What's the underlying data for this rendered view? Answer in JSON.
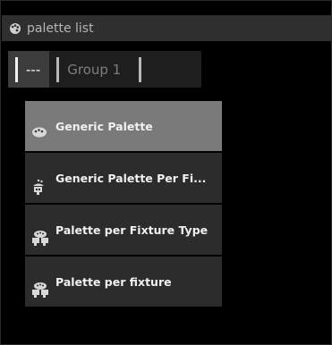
{
  "window": {
    "title": "palette list"
  },
  "tabs": [
    {
      "label": "---",
      "active": true
    },
    {
      "label": "Group 1",
      "active": false
    },
    {
      "label": "",
      "active": false
    }
  ],
  "palettes": [
    {
      "label": "Generic Palette",
      "icon": "palette-icon",
      "selected": true
    },
    {
      "label": "Generic Palette Per Fi...",
      "icon": "palette-fixture-icon",
      "selected": false
    },
    {
      "label": "Palette per Fixture Type",
      "icon": "palette-fixture-type-icon",
      "selected": false
    },
    {
      "label": "Palette per fixture",
      "icon": "palette-per-fixture-icon",
      "selected": false
    }
  ],
  "colors": {
    "accent": "#f2f2f2",
    "selected_bg": "#7a7a7a",
    "item_bg": "#2c2c2c"
  }
}
